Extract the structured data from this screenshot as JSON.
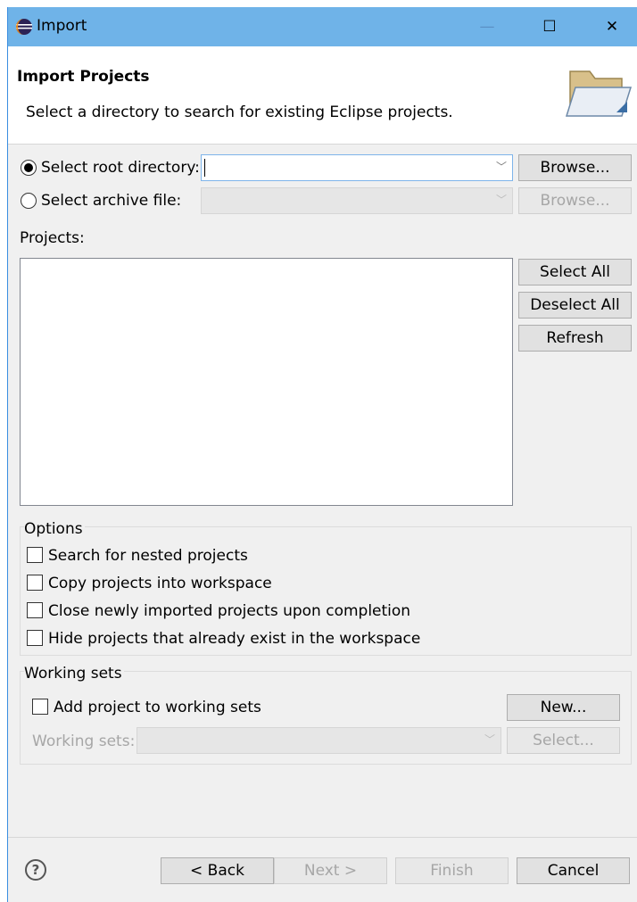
{
  "window": {
    "title": "Import",
    "controls": {
      "minimize": "—",
      "maximize": "☐",
      "close": "✕"
    }
  },
  "header": {
    "title": "Import Projects",
    "description": "Select a directory to search for existing Eclipse projects."
  },
  "source": {
    "root_directory_label": "Select root directory:",
    "root_directory_value": "",
    "archive_file_label": "Select archive file:",
    "archive_file_value": "",
    "browse_label": "Browse...",
    "selected": "root_directory"
  },
  "projects": {
    "label": "Projects:",
    "items": [],
    "select_all_label": "Select All",
    "deselect_all_label": "Deselect All",
    "refresh_label": "Refresh"
  },
  "options": {
    "title": "Options",
    "items": [
      {
        "label": "Search for nested projects",
        "checked": false
      },
      {
        "label": "Copy projects into workspace",
        "checked": false
      },
      {
        "label": "Close newly imported projects upon completion",
        "checked": false
      },
      {
        "label": "Hide projects that already exist in the workspace",
        "checked": false
      }
    ]
  },
  "working_sets": {
    "title": "Working sets",
    "add_label": "Add project to working sets",
    "add_checked": false,
    "sets_label": "Working sets:",
    "sets_value": "",
    "new_label": "New...",
    "select_label": "Select..."
  },
  "footer": {
    "help_symbol": "?",
    "back_label": "< Back",
    "next_label": "Next >",
    "finish_label": "Finish",
    "cancel_label": "Cancel"
  },
  "colors": {
    "titlebar": "#6fb3e8",
    "dialog_bg": "#f0f0f0",
    "disabled_text": "#a6a6a6"
  }
}
